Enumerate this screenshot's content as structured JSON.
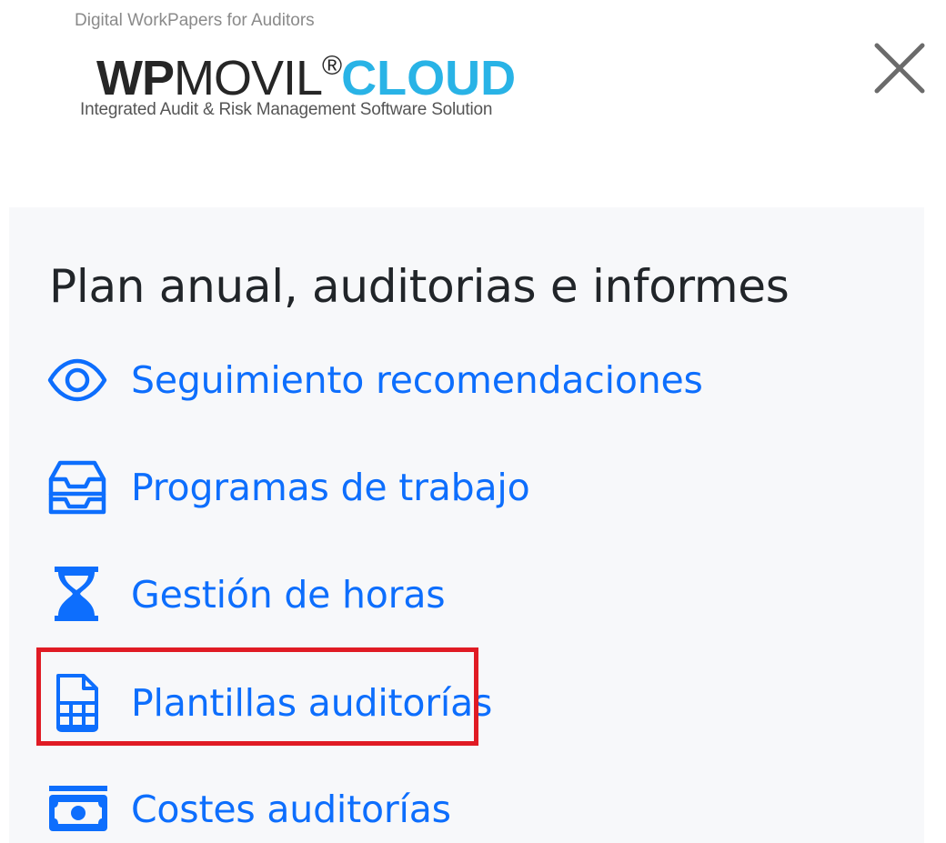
{
  "header": {
    "logo": {
      "tagline_top": "Digital WorkPapers for Auditors",
      "brand_wp": "WP",
      "brand_movil": "MOVIL",
      "brand_reg": "®",
      "brand_cloud": "CLOUD",
      "tagline_bottom": "Integrated Audit & Risk Management Software Solution"
    },
    "close_icon": "close-icon"
  },
  "menu": {
    "section_title": "Plan anual, auditorias e informes",
    "items": [
      {
        "label": "Seguimiento recomendaciones",
        "icon": "eye-icon"
      },
      {
        "label": "Programas de trabajo",
        "icon": "inbox-tray-icon"
      },
      {
        "label": "Gestión de horas",
        "icon": "hourglass-icon"
      },
      {
        "label": "Plantillas auditorías",
        "icon": "spreadsheet-file-icon"
      },
      {
        "label": "Costes auditorías",
        "icon": "cash-icon"
      }
    ]
  },
  "colors": {
    "link": "#0d6efd",
    "panel_bg": "#f7f8fa",
    "title": "#212529",
    "highlight": "#e01b24",
    "brand_cloud": "#29b3e6"
  }
}
